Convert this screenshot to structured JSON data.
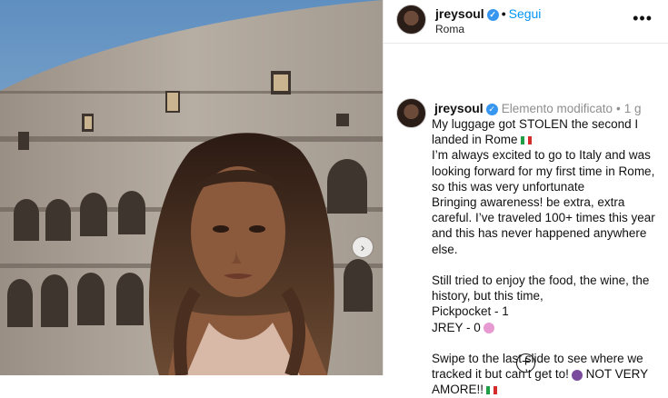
{
  "header": {
    "username": "jreysoul",
    "follow_label": "Segui",
    "location": "Roma",
    "separator": "•",
    "more_label": "•••"
  },
  "post": {
    "username": "jreysoul",
    "edited_label": "Elemento modificato",
    "time": "1 g",
    "caption_lines": [
      "My luggage got STOLEN the second I landed in Rome",
      "I’m always excited to go to Italy and was looking forward for my first time in Rome, so this was very unfortunate",
      "Bringing awareness! be extra, extra careful. I’ve traveled 100+ times this year and this has never happened anywhere else.",
      "Still tried to enjoy the food, the wine, the history, but this time,",
      "Pickpocket - 1",
      "JREY - 0",
      "Swipe to the last slide to see where we tracked it but can’t get to!",
      "NOT VERY AMORE!!"
    ]
  },
  "icons": {
    "verified": "verified-badge-icon",
    "more": "more-options-icon",
    "next": "chevron-right-icon",
    "add": "add-comment-icon",
    "flag": "italy-flag-icon"
  },
  "colors": {
    "accent": "#0095f6",
    "verified": "#3797f0",
    "muted": "#8e8e8e"
  },
  "glyphs": {
    "next": "›",
    "plus": "+",
    "check": "✓"
  }
}
